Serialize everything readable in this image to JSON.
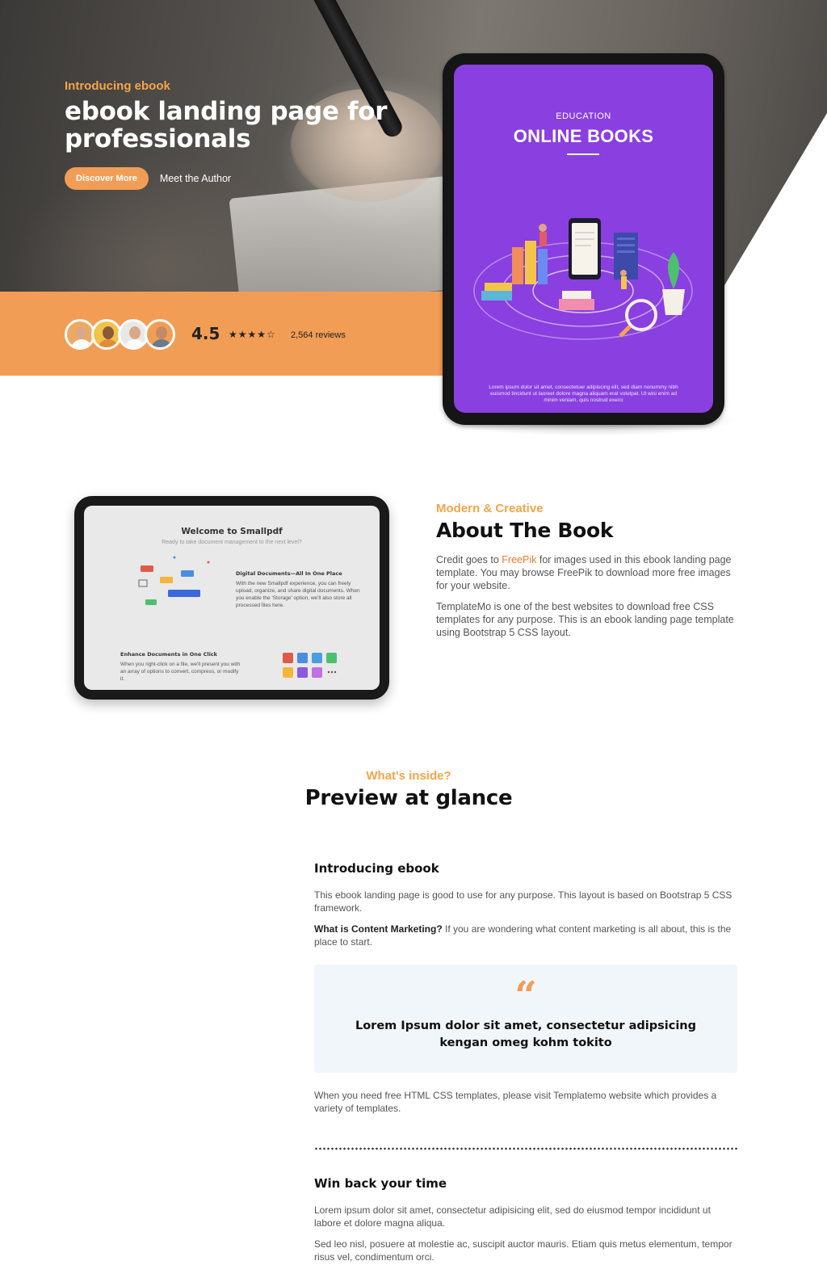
{
  "hero": {
    "eyebrow": "Introducing ebook",
    "title": "ebook landing page for professionals",
    "primary_button": "Discover More",
    "secondary_link": "Meet the Author"
  },
  "rating": {
    "score": "4.5",
    "stars_filled": 4,
    "stars_total": 5,
    "reviews": "2,564 reviews"
  },
  "tablet": {
    "eyebrow": "EDUCATION",
    "title": "ONLINE BOOKS",
    "caption": "Lorem ipsum dolor sit amet, consectetuer adipiscing elit, sed diam nonummy nibh euismod tincidunt ut laoreet dolore magna aliquam erat volutpat. Ut wisi enim ad minim veniam, quis nostrud exerci"
  },
  "about_tablet": {
    "title": "Welcome to Smallpdf",
    "subtitle": "Ready to take document management to the next level?",
    "block1_title": "Digital Documents—All In One Place",
    "block1_text": "With the new Smallpdf experience, you can freely upload, organize, and share digital documents. When you enable the 'Storage' option, we'll also store all processed files here.",
    "block2_title": "Enhance Documents in One Click",
    "block2_text": "When you right-click on a file, we'll present you with an array of options to convert, compress, or modify it."
  },
  "about": {
    "eyebrow": "Modern & Creative",
    "title": "About The Book",
    "para1_before": "Credit goes to ",
    "para1_link": "FreePik",
    "para1_after": " for images used in this ebook landing page template. You may browse FreePik to download more free images for your website.",
    "para2": "TemplateMo is one of the best websites to download free CSS templates for any purpose. This is an ebook landing page template using Bootstrap 5 CSS layout."
  },
  "preview": {
    "eyebrow": "What's inside?",
    "title": "Preview at glance",
    "section1_title": "Introducing ebook",
    "section1_para1": "This ebook landing page is good to use for any purpose. This layout is based on Bootstrap 5 CSS framework.",
    "section1_para2_bold": "What is Content Marketing?",
    "section1_para2_rest": " If you are wondering what content marketing is all about, this is the place to start.",
    "quote": "Lorem Ipsum dolor sit amet, consectetur adipsicing kengan omeg kohm tokito",
    "section1_para3": "When you need free HTML CSS templates, please visit Templatemo website which provides a variety of templates.",
    "section2_title": "Win back your time",
    "section2_para1": "Lorem ipsum dolor sit amet, consectetur adipisicing elit, sed do eiusmod tempor incididunt ut labore et dolore magna aliqua.",
    "section2_para2": "Sed leo nisl, posuere at molestie ac, suscipit auctor mauris. Etiam quis metus elementum, tempor risus vel, condimentum orci."
  },
  "colors": {
    "accent": "#f29d56",
    "eyebrow": "#f5a54a",
    "tablet_screen": "#8a3fe0",
    "quote_bg": "#f1f6fb",
    "link": "#f07a2a"
  }
}
